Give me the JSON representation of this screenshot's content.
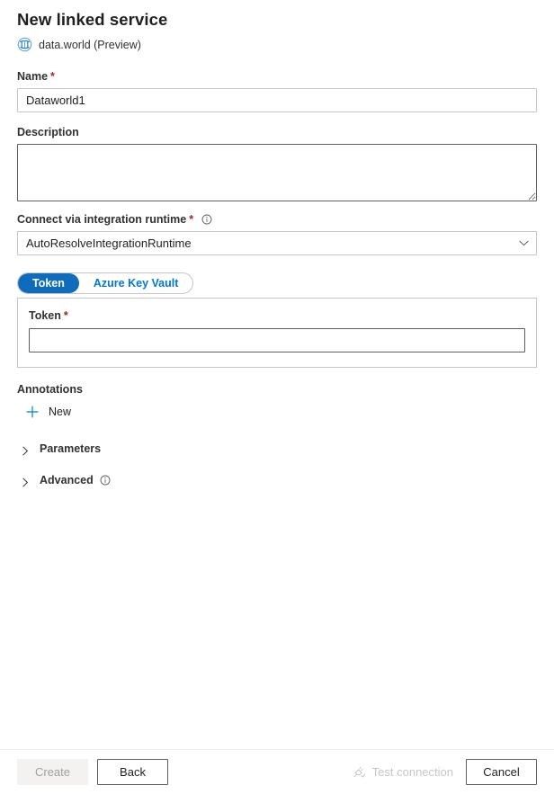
{
  "header": {
    "title": "New linked service",
    "service_icon": "dataworld-logo-icon",
    "subtitle": "data.world (Preview)"
  },
  "form": {
    "name": {
      "label": "Name",
      "required_marker": "*",
      "value": "Dataworld1",
      "placeholder": ""
    },
    "description": {
      "label": "Description",
      "value": "",
      "placeholder": ""
    },
    "integration_runtime": {
      "label": "Connect via integration runtime",
      "required_marker": "*",
      "info_icon": "info-icon",
      "value": "AutoResolveIntegrationRuntime",
      "chevron_icon": "chevron-down-icon"
    },
    "auth_tabs": {
      "selected": "Token",
      "items": [
        {
          "label": "Token",
          "selected": true
        },
        {
          "label": "Azure Key Vault",
          "selected": false
        }
      ]
    },
    "token": {
      "label": "Token",
      "required_marker": "*",
      "value": "",
      "placeholder": ""
    },
    "annotations": {
      "label": "Annotations",
      "new_label": "New",
      "new_icon": "plus-icon"
    },
    "sections": [
      {
        "label": "Parameters",
        "expanded": false,
        "chevron_icon": "chevron-right-icon",
        "info_icon": ""
      },
      {
        "label": "Advanced",
        "expanded": false,
        "chevron_icon": "chevron-right-icon",
        "info_icon": "info-icon"
      }
    ]
  },
  "footer": {
    "create_label": "Create",
    "back_label": "Back",
    "test_connection_label": "Test connection",
    "test_connection_icon": "plug-connection-icon",
    "cancel_label": "Cancel"
  },
  "colors": {
    "accent": "#0078d4",
    "accent_selected": "#0f6cbd",
    "required": "#a4262c",
    "border": "#c8c6c4",
    "border_strong": "#605e5c",
    "disabled_text": "#a19f9d",
    "text": "#201f1e"
  }
}
